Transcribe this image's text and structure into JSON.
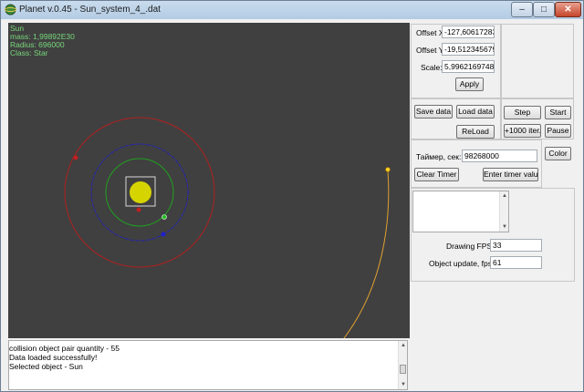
{
  "window": {
    "title": "Planet v.0.45 - Sun_system_4_.dat"
  },
  "titlebar_buttons": {
    "minimize": "–",
    "maximize": "□",
    "close": "✕"
  },
  "info_overlay": [
    "Sun",
    "mass: 1,99892E30",
    "Radius: 696000",
    "Class: Star"
  ],
  "colors": {
    "canvas_bg": "#404040",
    "sun": "#d6d400",
    "orbit_red": "#b02020",
    "orbit_blue": "#2020c0",
    "orbit_green": "#20a020",
    "trajectory": "#e0a030",
    "selection": "#d8d8d8"
  },
  "view": {
    "offset_x_label": "Offset X:",
    "offset_x_value": "-127,606172839",
    "offset_y_label": "Offset Y:",
    "offset_y_value": "-19,5123456790",
    "scale_label": "Scale:",
    "scale_value": "5,996216974838",
    "apply_label": "Apply"
  },
  "data_buttons": {
    "save": "Save data",
    "load": "Load data",
    "reload": "ReLoad"
  },
  "sim_buttons": {
    "step": "Step",
    "start": "Start",
    "thousand": "+1000 iter.",
    "pause": "Pause"
  },
  "timer": {
    "label": "Таймер, сек:",
    "value": "98268000",
    "clear": "Clear Timer",
    "enter": "Enter timer value",
    "color": "Color"
  },
  "stats": {
    "fps_label": "Drawing FPS:",
    "fps_value": "33",
    "ups_label": "Object update, fps:",
    "ups_value": "61"
  },
  "log": [
    "collision object pair quantity - 55",
    "Data loaded successfully!",
    "Selected object - Sun"
  ]
}
